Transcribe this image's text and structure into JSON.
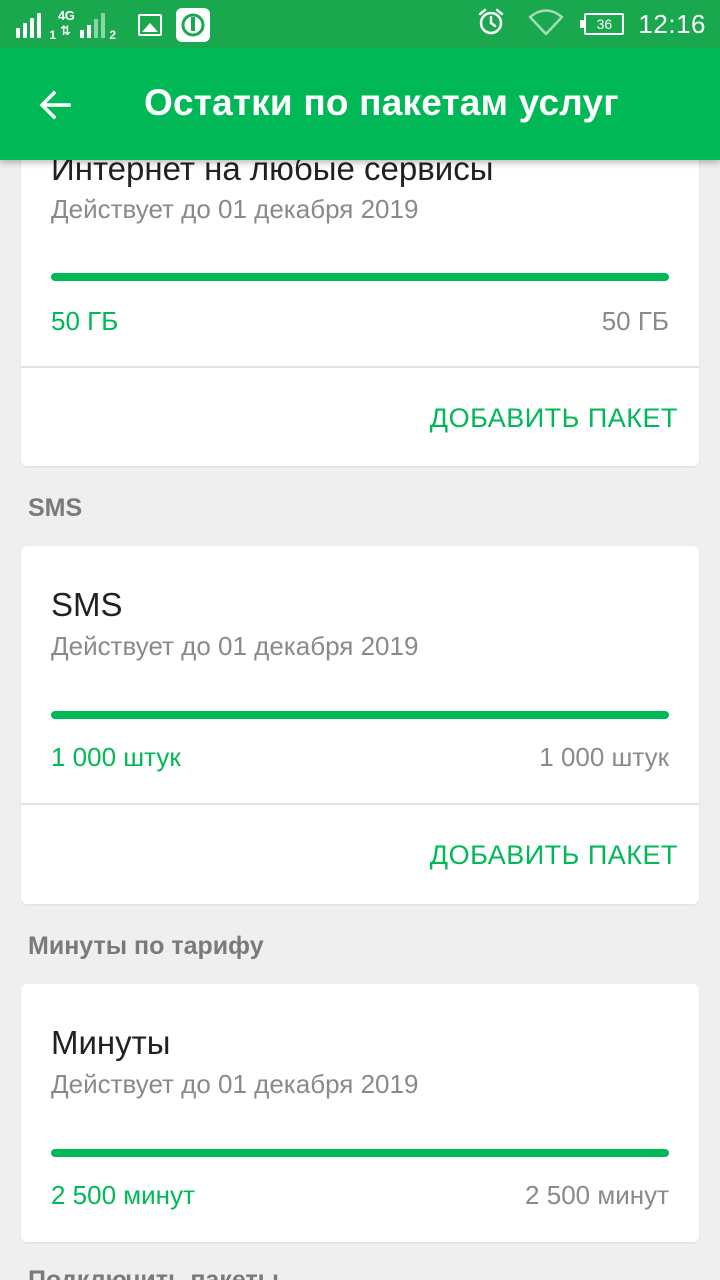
{
  "status_bar": {
    "sim1_label": "1",
    "network_type": "4G",
    "sim2_label": "2",
    "battery": "36",
    "time": "12:16"
  },
  "app_bar": {
    "title": "Остатки по пакетам услуг"
  },
  "sections": [
    {
      "title": "",
      "cards": [
        {
          "name": "Интернет на любые сервисы",
          "valid_until": "Действует до 01 декабря 2019",
          "remaining": "50 ГБ",
          "total": "50 ГБ",
          "progress_fraction": 1.0,
          "add_label": "ДОБАВИТЬ ПАКЕТ"
        }
      ]
    },
    {
      "title": "SMS",
      "cards": [
        {
          "name": "SMS",
          "valid_until": "Действует до 01 декабря 2019",
          "remaining": "1 000 штук",
          "total": "1 000 штук",
          "progress_fraction": 1.0,
          "add_label": "ДОБАВИТЬ ПАКЕТ"
        }
      ]
    },
    {
      "title": "Минуты по тарифу",
      "cards": [
        {
          "name": "Минуты",
          "valid_until": "Действует до 01 декабря 2019",
          "remaining": "2 500 минут",
          "total": "2 500 минут",
          "progress_fraction": 1.0
        }
      ]
    },
    {
      "title": "Подключить пакеты"
    }
  ],
  "colors": {
    "accent": "#00b956",
    "status_bar": "#1aa84e",
    "background": "#efefef"
  }
}
